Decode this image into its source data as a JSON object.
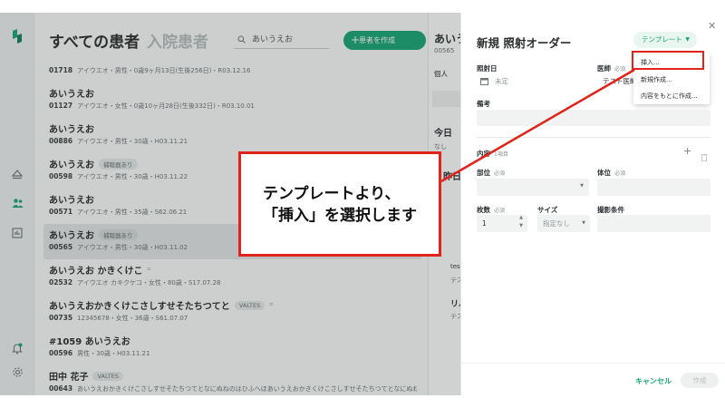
{
  "list": {
    "title_all": "すべての患者",
    "title_inpatient": "入院患者",
    "search_value": "あいうえお",
    "create_label": "患者を作成",
    "patients": [
      {
        "name": "",
        "badges": [],
        "id": "01718",
        "info": "アイウエオ・男性・0歳9ヶ月13日(生後256日)・R03.12.16"
      },
      {
        "name": "あいうえお",
        "badges": [],
        "id": "01127",
        "info": "アイウエオ・女性・0歳10ヶ月28日(生後332日)・R03.10.01"
      },
      {
        "name": "あいうえお",
        "badges": [],
        "id": "00886",
        "info": "アイウエオ・男性・30歳・H03.11.21"
      },
      {
        "name": "あいうえお",
        "badges": [
          "補聴器あり"
        ],
        "id": "00598",
        "info": "アイウエオ・男性・30歳・H03.11.22"
      },
      {
        "name": "あいうえお",
        "badges": [],
        "id": "00571",
        "info": "アイウエオ・男性・35歳・S62.06.21"
      },
      {
        "name": "あいうえお",
        "badges": [
          "補聴器あり"
        ],
        "id": "00565",
        "info": "アイウエオ・男性・30歳・H03.11.02"
      },
      {
        "name": "あいうえお かきくけこ",
        "badges": [],
        "id": "02532",
        "info": "アイウエオ カキクケコ・女性・80歳・S17.07.28"
      },
      {
        "name": "あいうえおかきくけこさしすせそたちつてと",
        "badges": [
          "VALTES"
        ],
        "id": "00735",
        "info": "12345678・女性・36歳・S61.07.07"
      },
      {
        "name": "#1059 あいうえお",
        "badges": [],
        "id": "00596",
        "info": "男性・30歳・H03.11.21"
      },
      {
        "name": "田中 花子",
        "badges": [
          "VALTES"
        ],
        "id": "00643",
        "info": "あいうえおかきくけこさしすせそたちつてとなにぬねのはひふへほあいうえおかきくけこさしすせそたちつてとなにぬねのはひふ"
      }
    ]
  },
  "detail": {
    "name_partial": "あいう",
    "id_partial": "00565",
    "tab": "個人",
    "today_label": "今日",
    "today_none": "なし",
    "yesterday_label": "昨日",
    "item_a": "testi",
    "item_a_sub": "テス",
    "item_b": "リハ",
    "item_b_sub": "テス"
  },
  "drawer": {
    "title": "新規 照射オーダー",
    "template_label": "テンプレート",
    "template_menu": [
      "挿入...",
      "新規作成...",
      "内容をもとに作成..."
    ],
    "date_label": "照射日",
    "date_placeholder": "未定",
    "doctor_label": "医師",
    "doctor_required": "必須",
    "doctor_value": "テスト医師",
    "note_label": "備考",
    "content_label": "内容",
    "content_count": "1項目",
    "part_label": "部位",
    "part_required": "必須",
    "position_label": "体位",
    "position_required": "必須",
    "count_label": "枚数",
    "count_required": "必須",
    "count_value": "1",
    "size_label": "サイズ",
    "size_value": "指定なし",
    "condition_label": "撮影条件",
    "cancel_label": "キャンセル",
    "submit_label": "作成"
  },
  "annotation": {
    "line1": "テンプレートより、",
    "line2": "「挿入」を選択します"
  },
  "colors": {
    "accent": "#19a778",
    "annotation_red": "#e0241b"
  }
}
